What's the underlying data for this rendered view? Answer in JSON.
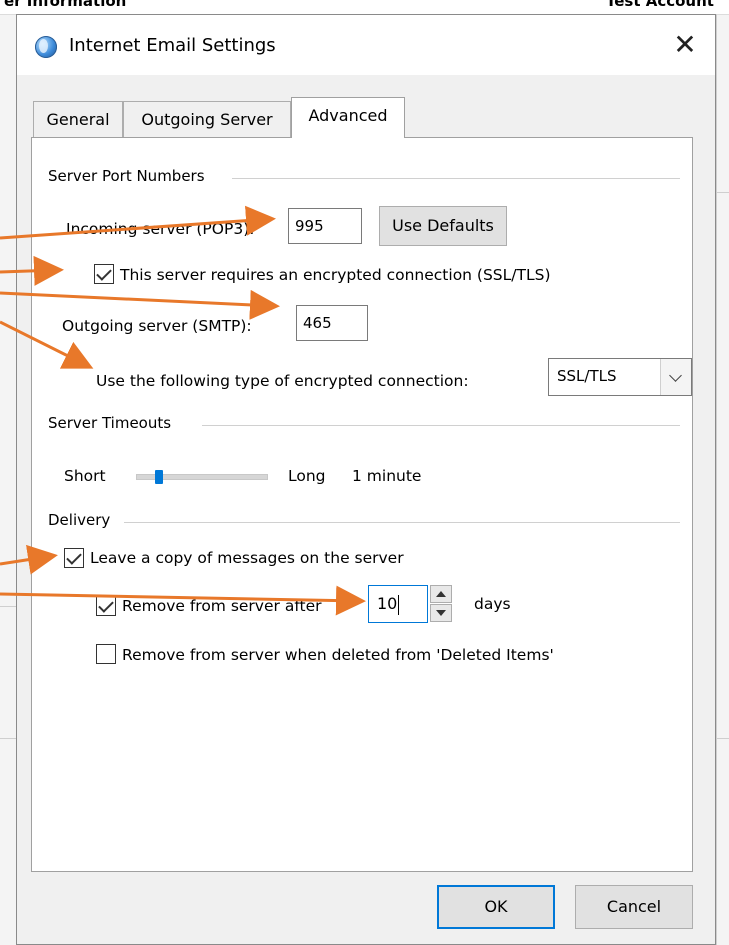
{
  "background": {
    "top_left_text": "er Information",
    "top_right_text": "Test Account"
  },
  "dialog": {
    "title": "Internet Email Settings",
    "close_glyph": "✕",
    "tabs": [
      "General",
      "Outgoing Server",
      "Advanced"
    ],
    "active_tab": "Advanced"
  },
  "server_ports": {
    "group_title": "Server Port Numbers",
    "incoming_label": "Incoming server (POP3):",
    "incoming_value": "995",
    "use_defaults_label": "Use Defaults",
    "encrypted_label": "This server requires an encrypted connection (SSL/TLS)",
    "encrypted_checked": true,
    "outgoing_label": "Outgoing server (SMTP):",
    "outgoing_value": "465",
    "encryption_type_label": "Use the following type of encrypted connection:",
    "encryption_type_value": "SSL/TLS"
  },
  "timeouts": {
    "group_title": "Server Timeouts",
    "short_label": "Short",
    "long_label": "Long",
    "value_label": "1 minute",
    "slider_level": 0.15
  },
  "delivery": {
    "group_title": "Delivery",
    "leave_copy_label": "Leave a copy of messages on the server",
    "leave_copy_checked": true,
    "remove_after_label": "Remove from server after",
    "remove_after_checked": true,
    "remove_after_value": "10",
    "days_label": "days",
    "remove_deleted_label": "Remove from server when deleted from 'Deleted Items'",
    "remove_deleted_checked": false
  },
  "footer": {
    "ok_label": "OK",
    "cancel_label": "Cancel"
  },
  "colors": {
    "annotation_arrow": "#e8782a",
    "accent": "#0078d7"
  }
}
